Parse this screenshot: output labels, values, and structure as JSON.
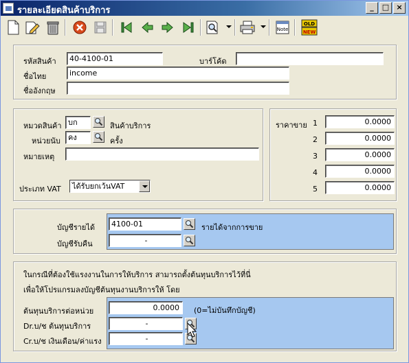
{
  "window": {
    "title": "รายละเอียดสินค้าบริการ",
    "minimize": "_",
    "maximize": "□",
    "close": "×"
  },
  "toolbar": {
    "items": [
      "new-icon",
      "edit-icon",
      "delete-icon",
      "cancel-icon",
      "save-icon",
      "first-icon",
      "previous-icon",
      "next-icon",
      "last-icon",
      "search-icon",
      "print-icon",
      "note-icon",
      "old-new-icon"
    ],
    "note_label": "Note",
    "old_label": "OLD",
    "new_label": "NEW"
  },
  "header": {
    "code_label": "รหัสสินค้า",
    "code_value": "40-4100-01",
    "barcode_label": "บาร์โค้ด",
    "barcode_value": "",
    "thai_name_label": "ชื่อไทย",
    "thai_name_value": "income",
    "eng_name_label": "ชื่ออังกฤษ",
    "eng_name_value": ""
  },
  "details": {
    "category_label": "หมวดสินค้า",
    "category_code": "บก",
    "category_name": "สินค้าบริการ",
    "unit_label": "หน่วยนับ",
    "unit_code": "คง",
    "unit_name": "ครั้ง",
    "remark_label": "หมายเหตุ",
    "remark_value": "",
    "vat_label": "ประเภท VAT",
    "vat_value": "ได้รับยกเว้นVAT"
  },
  "prices": {
    "label": "ราคาขาย",
    "rows": [
      {
        "num": "1",
        "value": "0.0000"
      },
      {
        "num": "2",
        "value": "0.0000"
      },
      {
        "num": "3",
        "value": "0.0000"
      },
      {
        "num": "4",
        "value": "0.0000"
      },
      {
        "num": "5",
        "value": "0.0000"
      }
    ]
  },
  "accounts": {
    "income_label": "บัญชีรายได้",
    "income_code": "4100-01",
    "income_name": "รายได้จากการขาย",
    "return_label": "บัญชีรับคืน",
    "return_code": "-"
  },
  "cost": {
    "note_line1": "ในกรณีที่ต้องใช้แรงงานในการให้บริการ สามารถตั้งต้นทุนบริการไว้ที่นี่",
    "note_line2": "เพื่อให้โปรแกรมลงบัญชีต้นทุนงานบริการให้ โดย",
    "unit_cost_label": "ต้นทุนบริการต่อหน่วย",
    "unit_cost_value": "0.0000",
    "unit_cost_hint": "(0=ไม่บันทึกบัญชี)",
    "dr_label": "Dr.บ/ช ต้นทุนบริการ",
    "dr_value": "-",
    "cr_label": "Cr.บ/ช เงินเดือน/ค่าแรง",
    "cr_value": "-"
  }
}
